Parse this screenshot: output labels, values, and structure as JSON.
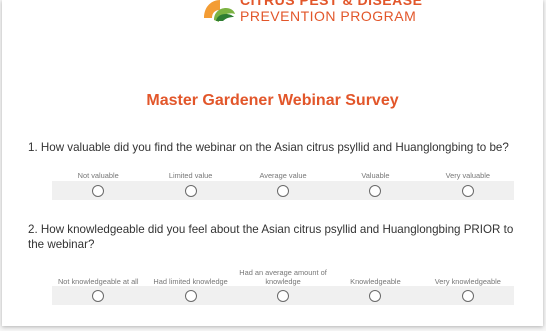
{
  "logo": {
    "line1": "CITRUS PEST & DISEASE",
    "line2": "PREVENTION PROGRAM"
  },
  "survey": {
    "title": "Master Gardener Webinar Survey",
    "questions": [
      {
        "text": "1. How valuable did you find the webinar on the Asian citrus psyllid and Huanglongbing to be?",
        "options": [
          "Not valuable",
          "Limited value",
          "Average value",
          "Valuable",
          "Very valuable"
        ]
      },
      {
        "text": "2. How knowledgeable did you feel about the Asian citrus psyllid and Huanglongbing PRIOR to the webinar?",
        "options": [
          "Not knowledgeable at all",
          "Had limited knowledge",
          "Had an average amount of knowledge",
          "Knowledgeable",
          "Very knowledgeable"
        ]
      }
    ]
  },
  "colors": {
    "accent": "#e2562a",
    "logo_green": "#7cb342",
    "logo_orange": "#f39c34"
  }
}
